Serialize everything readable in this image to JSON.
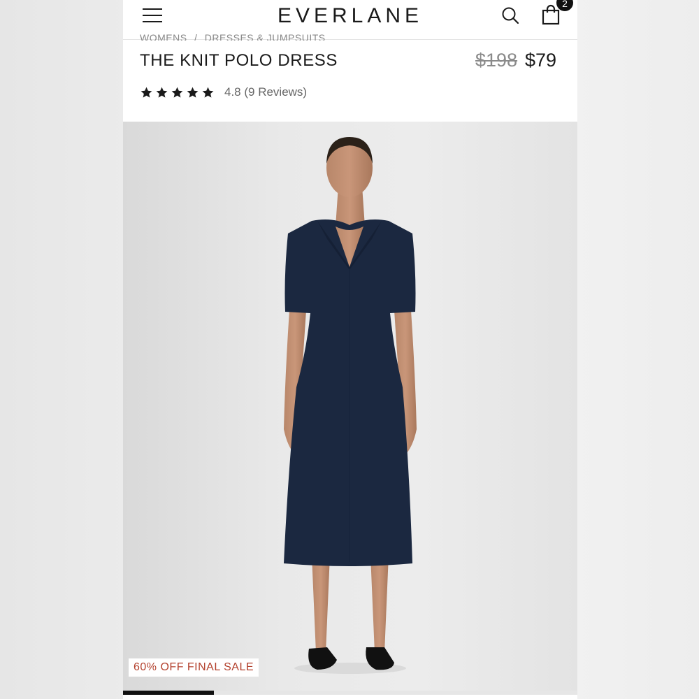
{
  "header": {
    "logo": "EVERLANE",
    "cart_count": "2",
    "icons": [
      "menu-icon",
      "search-icon",
      "bag-icon"
    ]
  },
  "breadcrumb": {
    "items": [
      "WOMENS",
      "DRESSES & JUMPSUITS"
    ],
    "separator": "/"
  },
  "product": {
    "title": "THE KNIT POLO DRESS",
    "original_price": "$198",
    "sale_price": "$79",
    "rating_stars": 5,
    "rating_text": "4.8 (9 Reviews)",
    "badge": "60% OFF FINAL SALE",
    "gallery_progress": 0.2
  },
  "colors": {
    "accent_sale": "#b3402c",
    "dress_navy": "#1b2840",
    "text_primary": "#1a1a1a"
  }
}
